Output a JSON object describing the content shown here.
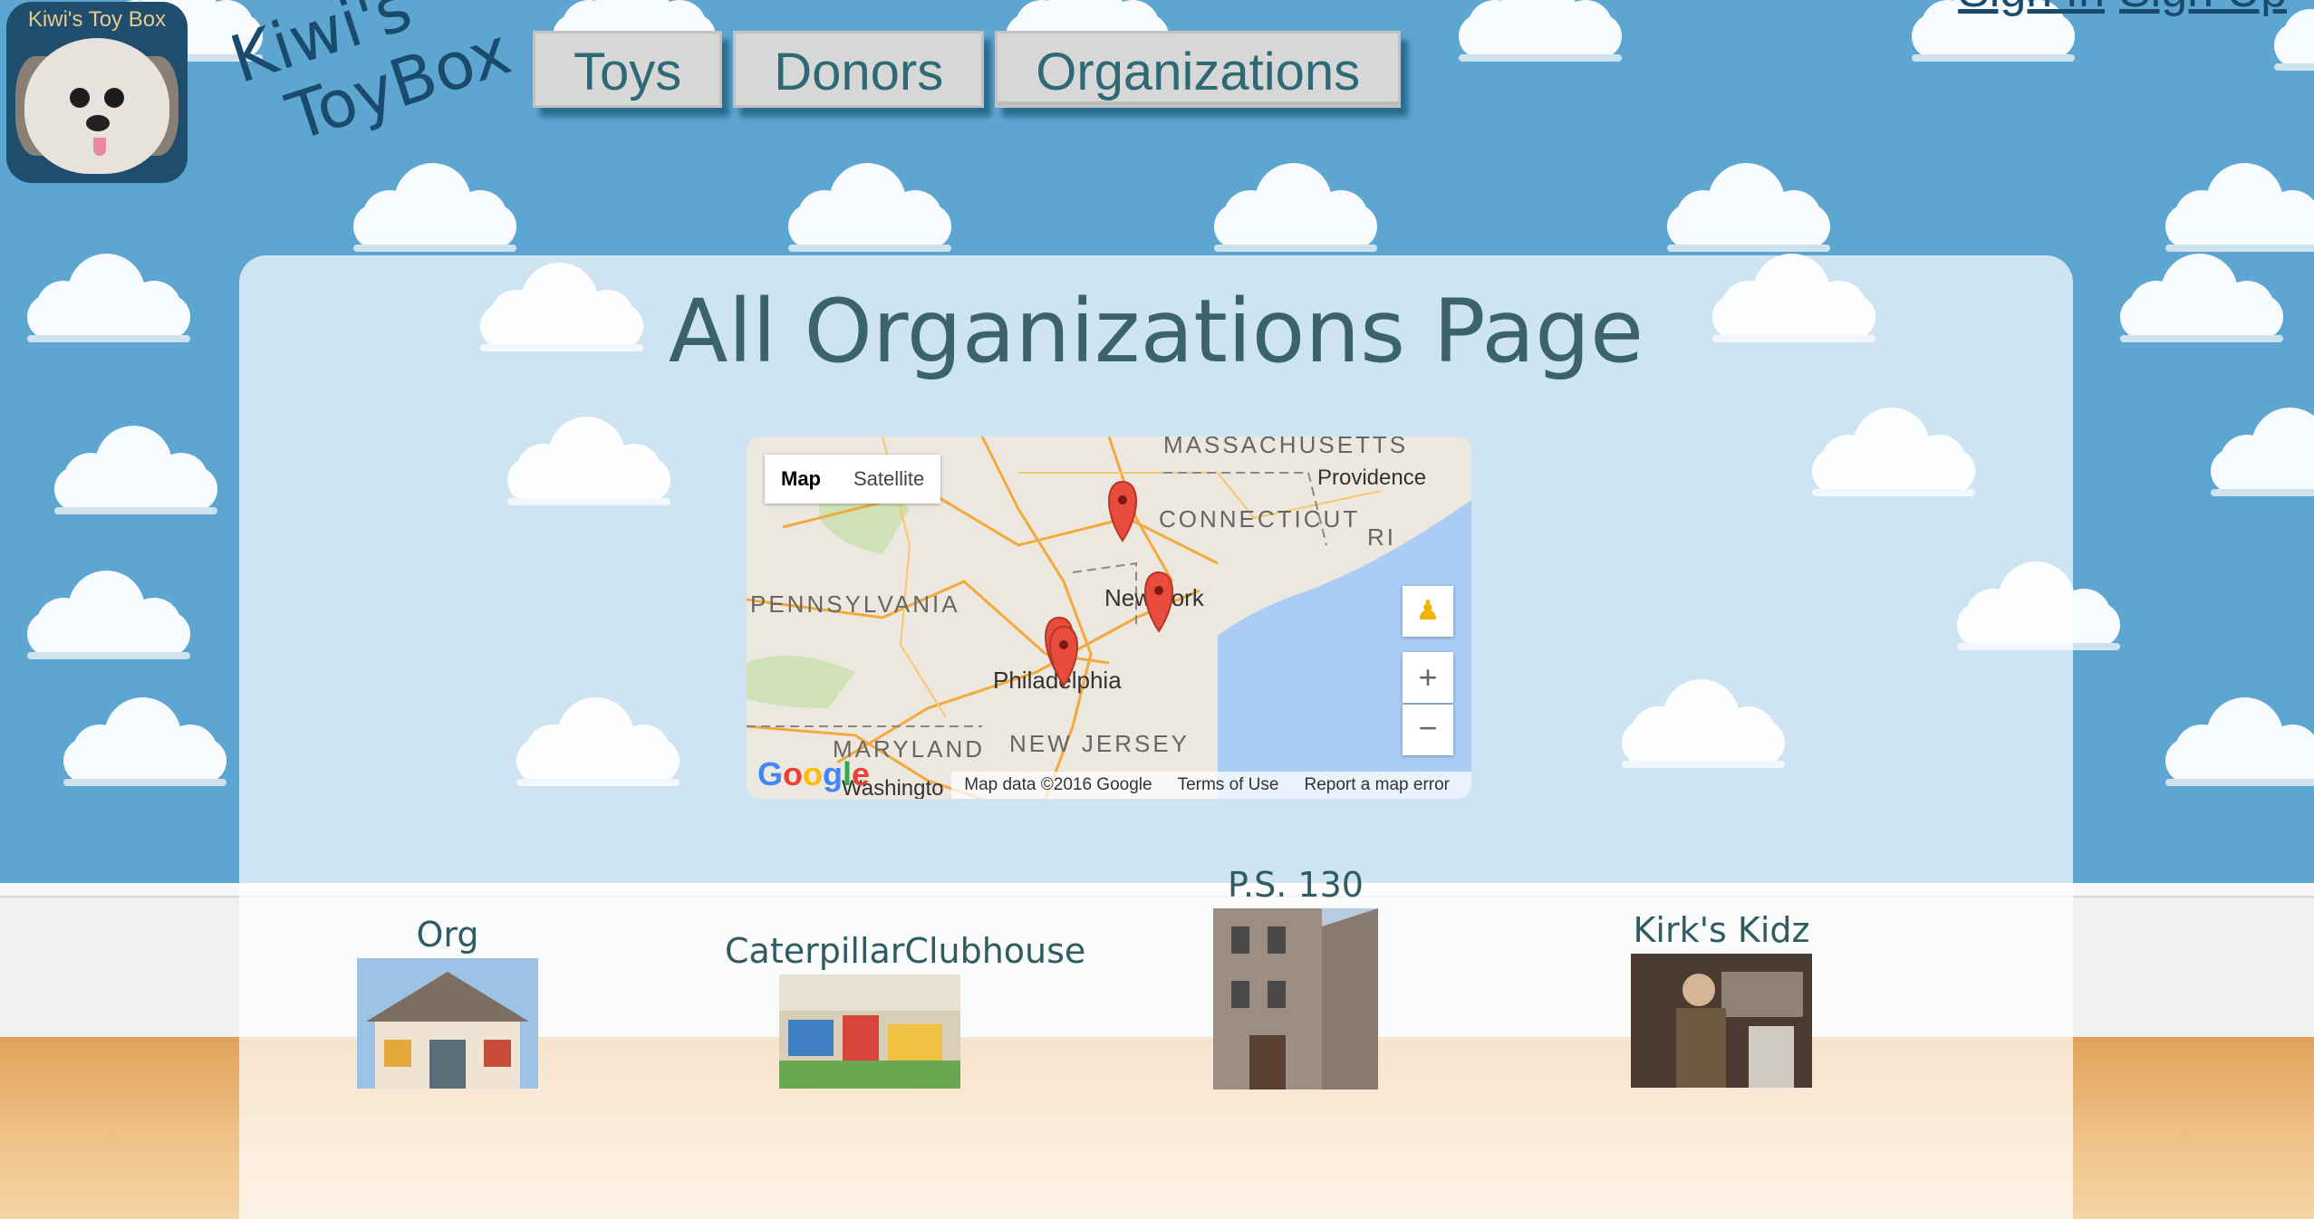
{
  "header": {
    "logo_text": "Kiwi's Toy Box",
    "brand_line1": "Kiwi's",
    "brand_line2": "ToyBox"
  },
  "nav": {
    "items": [
      {
        "label": "Toys"
      },
      {
        "label": "Donors"
      },
      {
        "label": "Organizations"
      }
    ]
  },
  "auth": {
    "sign_in": "Sign In",
    "sign_up": "Sign Up"
  },
  "main": {
    "title": "All Organizations Page"
  },
  "map": {
    "toggle_map": "Map",
    "toggle_satellite": "Satellite",
    "labels": {
      "massachusetts": "MASSACHUSETTS",
      "providence": "Providence",
      "connecticut": "CONNECTICUT",
      "ri": "RI",
      "pennsylvania": "PENNSYLVANIA",
      "new_york": "New York",
      "philadelphia": "Philadelphia",
      "maryland": "MARYLAND",
      "new_jersey": "NEW JERSEY",
      "washington": "Washingto"
    },
    "zoom_in": "+",
    "zoom_out": "−",
    "google": "Google",
    "attribution": "Map data ©2016 Google",
    "terms": "Terms of Use",
    "report": "Report a map error"
  },
  "organizations": [
    {
      "name": "Org"
    },
    {
      "name": "CaterpillarClubhouse"
    },
    {
      "name": "P.S. 130"
    },
    {
      "name": "Kirk's Kidz"
    }
  ],
  "colors": {
    "sky": "#5ea6d2",
    "nav_text": "#2d6a75",
    "title": "#3a6469",
    "marker": "#e84c3d"
  }
}
